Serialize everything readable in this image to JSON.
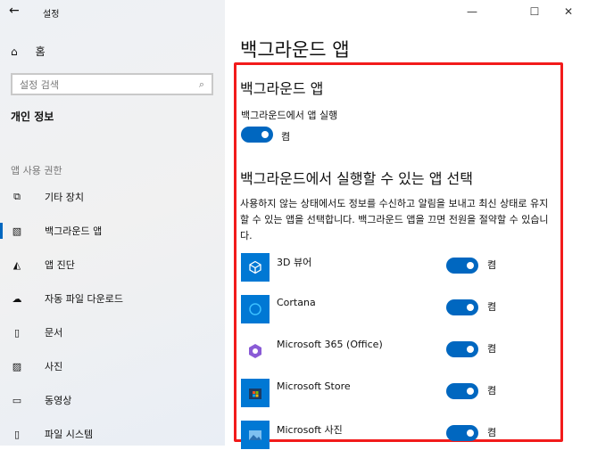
{
  "window": {
    "title": "설정",
    "back": "←",
    "minimize": "—",
    "maximize": "☐",
    "close": "✕"
  },
  "sidebar": {
    "home": "홈",
    "search_placeholder": "설정 검색",
    "section": "개인 정보",
    "group": "앱 사용 권한",
    "items": [
      {
        "label": "기타 장치",
        "icon": "devices-icon",
        "glyph": "⧉"
      },
      {
        "label": "백그라운드 앱",
        "icon": "background-apps-icon",
        "glyph": "▧",
        "selected": true
      },
      {
        "label": "앱 진단",
        "icon": "app-diagnostics-icon",
        "glyph": "◭"
      },
      {
        "label": "자동 파일 다운로드",
        "icon": "cloud-icon",
        "glyph": "☁"
      },
      {
        "label": "문서",
        "icon": "document-icon",
        "glyph": "▯"
      },
      {
        "label": "사진",
        "icon": "picture-icon",
        "glyph": "▨"
      },
      {
        "label": "동영상",
        "icon": "video-icon",
        "glyph": "▭"
      },
      {
        "label": "파일 시스템",
        "icon": "file-icon",
        "glyph": "▯"
      }
    ]
  },
  "main": {
    "page_title": "백그라운드 앱",
    "section1": "백그라운드 앱",
    "run_label": "백그라운드에서 앱 실행",
    "run_state": "켬",
    "section2": "백그라운드에서 실행할 수 있는 앱 선택",
    "description": "사용하지 않는 상태에서도 정보를 수신하고 알림을 보내고 최신 상태로 유지할 수 있는 앱을 선택합니다. 백그라운드 앱을 끄면 전원을 절약할 수 있습니다.",
    "apps": [
      {
        "name": "3D 뷰어",
        "state": "켬"
      },
      {
        "name": "Cortana",
        "state": "켬"
      },
      {
        "name": "Microsoft 365 (Office)",
        "state": "켬"
      },
      {
        "name": "Microsoft Store",
        "state": "켬"
      },
      {
        "name": "Microsoft 사진",
        "state": "켬"
      }
    ]
  },
  "colors": {
    "accent": "#0067c0",
    "highlight": "#f21b1b"
  }
}
